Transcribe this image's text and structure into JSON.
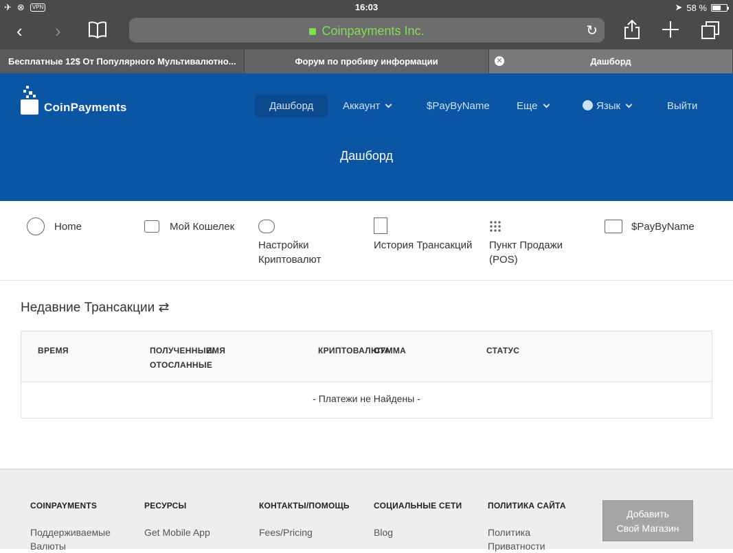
{
  "statusbar": {
    "vpn": "VPN",
    "time": "16:03",
    "battery": "58 %",
    "battery_level": 0.58
  },
  "browser": {
    "url": "Coinpayments Inc.",
    "tabs": [
      {
        "title": "Бесплатные 12$ От Популярного Мультивалютно..."
      },
      {
        "title": "Форум по пробиву информации"
      },
      {
        "title": "Дашборд"
      }
    ]
  },
  "header": {
    "brand": "CoinPayments",
    "nav": {
      "dashboard": "Дашборд",
      "account": "Аккаунт",
      "paybyname": "$PayByName",
      "more": "Еще",
      "language": "Язык",
      "logout": "Выйти"
    },
    "page_title": "Дашборд"
  },
  "quicklinks": {
    "home": "Home",
    "wallet": "Мой Кошелек",
    "crypto_settings_1": "Настройки",
    "crypto_settings_2": "Криптовалют",
    "history": "История Трансакций",
    "pos_1": "Пункт Продажи",
    "pos_2": "(POS)",
    "paybyname": "$PayByName"
  },
  "transactions": {
    "title": "Недавние Трансакции ⇄",
    "columns": {
      "time": "ВРЕМЯ",
      "received": "ПОЛУЧЕННЫЕ/",
      "sent": "ОТОСЛАННЫЕ",
      "name": "ИМЯ",
      "crypto": "КРИПТОВАЛЮТА",
      "amount": "СУММА",
      "status": "СТАТУС"
    },
    "empty": "- Платежи не Найдены -"
  },
  "footer": {
    "coinpayments": {
      "title": "COINPAYMENTS",
      "link_1": "Поддерживаемые",
      "link_2": "Валюты"
    },
    "resources": {
      "title": "РЕСУРСЫ",
      "link": "Get Mobile App"
    },
    "contacts": {
      "title": "КОНТАКТЫ/ПОМОЩЬ",
      "link": "Fees/Pricing"
    },
    "social": {
      "title": "СОЦИАЛЬНЫЕ СЕТИ",
      "link": "Blog"
    },
    "policy": {
      "title": "ПОЛИТИКА САЙТА",
      "link_1": "Политика",
      "link_2": "Приватности"
    },
    "add_store_1": "Добавить",
    "add_store_2": "Свой Магазин"
  },
  "colors": {
    "header_bg": "#0a56a5",
    "url_green": "#7ee04a",
    "chrome": "#4a4a4a"
  }
}
